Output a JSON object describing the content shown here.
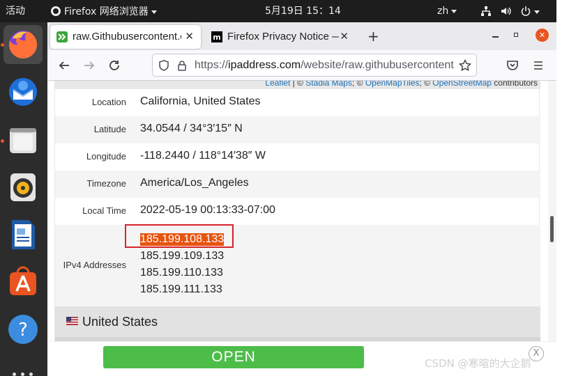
{
  "topbar": {
    "activities": "活动",
    "app_name": "Firefox 网络浏览器",
    "clock": "5月19日  15：14",
    "lang": "zh"
  },
  "tabs": [
    {
      "title": "raw.Githubusercontent.c",
      "active": true
    },
    {
      "title": "Firefox Privacy Notice —",
      "active": false
    }
  ],
  "urlbar": {
    "prefix": "https://",
    "domain": "ipaddress.com",
    "path": "/website/raw.githubusercontent.com"
  },
  "attribution": {
    "leaflet": "Leaflet",
    "sep1": " | © ",
    "stadia": "Stadia Maps",
    "sep2": "; © ",
    "openmaptiles": "OpenMapTiles",
    "sep3": "; © ",
    "osm": "OpenStreetMap",
    "suffix": " contributors"
  },
  "details": {
    "location": {
      "label": "Location",
      "value": "California, United States"
    },
    "latitude": {
      "label": "Latitude",
      "value": "34.0544 / 34°3′15″ N"
    },
    "longitude": {
      "label": "Longitude",
      "value": "-118.2440 / 118°14′38″ W"
    },
    "timezone": {
      "label": "Timezone",
      "value": "America/Los_Angeles"
    },
    "local_time": {
      "label": "Local Time",
      "value": "2022-05-19 00:13:33-07:00"
    },
    "ipv4": {
      "label": "IPv4 Addresses",
      "values": [
        "185.199.108.133",
        "185.199.109.133",
        "185.199.110.133",
        "185.199.111.133"
      ]
    }
  },
  "country_header": "United States",
  "ad": {
    "button_label": "OPEN",
    "close_label": "X"
  },
  "watermark": "CSDN @寒暄的大企鹅",
  "colors": {
    "selection": "#e8530e",
    "highlight_box": "#d6232a",
    "open_button": "#4dbd4a"
  }
}
